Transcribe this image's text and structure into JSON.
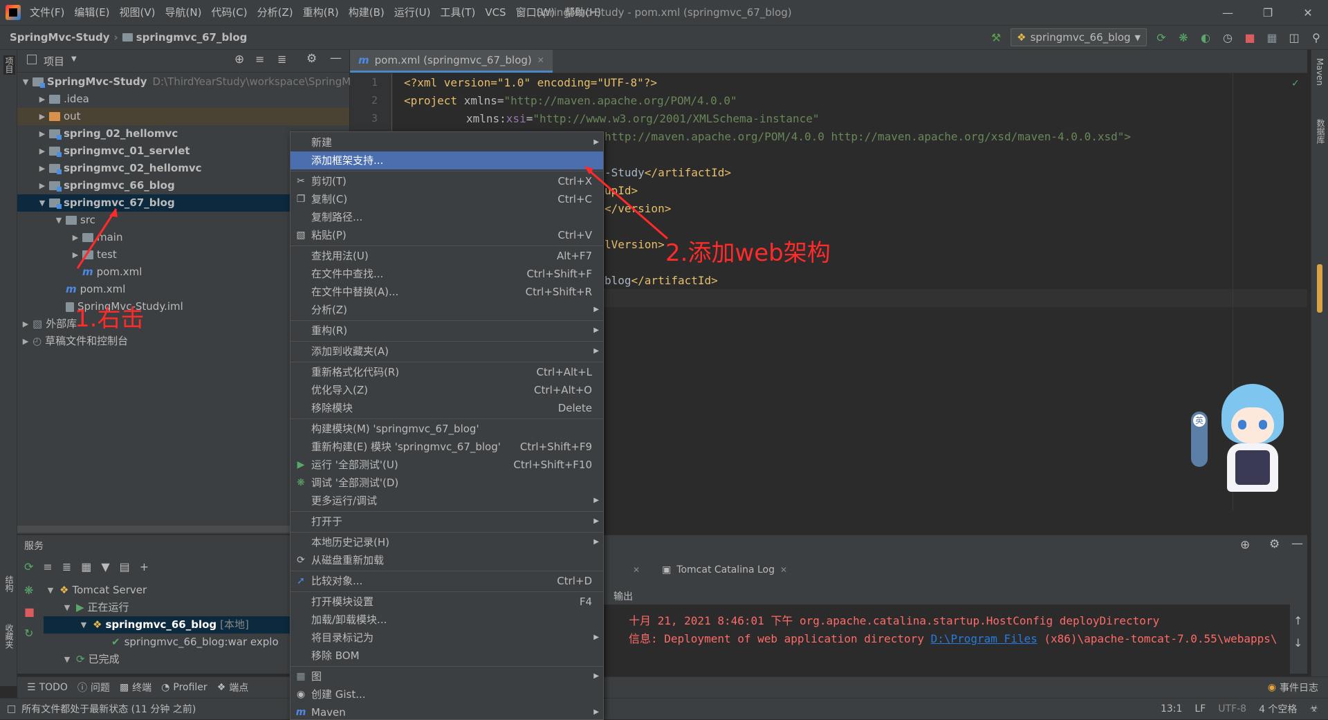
{
  "titlebar": {
    "menu": [
      "文件(F)",
      "编辑(E)",
      "视图(V)",
      "导航(N)",
      "代码(C)",
      "分析(Z)",
      "重构(R)",
      "构建(B)",
      "运行(U)",
      "工具(T)",
      "VCS",
      "窗口(W)",
      "帮助(H)"
    ],
    "window_title": "SpringMvc-Study - pom.xml (springmvc_67_blog)"
  },
  "navbar": {
    "crumb_project": "SpringMvc-Study",
    "crumb_module": "springmvc_67_blog",
    "run_config": "springmvc_66_blog"
  },
  "project_panel": {
    "title": "项目",
    "root_name": "SpringMvc-Study",
    "root_path": "D:\\ThirdYearStudy\\workspace\\SpringM",
    "items": [
      ".idea",
      "out",
      "spring_02_hellomvc",
      "springmvc_01_servlet",
      "springmvc_02_hellomvc",
      "springmvc_66_blog",
      "springmvc_67_blog",
      "src",
      "main",
      "test",
      "pom.xml",
      "pom.xml",
      "SpringMvc-Study.iml",
      "外部库",
      "草稿文件和控制台"
    ]
  },
  "editor": {
    "tab_label": "pom.xml (springmvc_67_blog)",
    "line_numbers": [
      "1",
      "2",
      "3"
    ],
    "code": {
      "l1": "<?xml version=\"1.0\" encoding=\"UTF-8\"?>",
      "l2_tag": "<project ",
      "l2_attr": "xmlns=",
      "l2_val": "\"http://maven.apache.org/POM/4.0.0\"",
      "l3_attr": "xmlns:",
      "l3_ns": "xsi",
      "l3_eq": "=",
      "l3_val": "\"http://www.w3.org/2001/XMLSchema-instance\"",
      "l4_val": "http://maven.apache.org/POM/4.0.0 http://maven.apache.org/xsd/maven-4.0.0.xsd\">",
      "l6_text": "-Study",
      "l6_tag": "</artifactId>",
      "l7_text": "upId>",
      "l8_tag": "</version>",
      "l10_text": "lVersion>",
      "l12_text": "blog",
      "l12_tag": "</artifactId>"
    }
  },
  "context_menu": {
    "items": [
      {
        "label": "新建",
        "shortcut": ""
      },
      {
        "label": "添加框架支持...",
        "shortcut": ""
      },
      {
        "label": "剪切(T)",
        "shortcut": "Ctrl+X"
      },
      {
        "label": "复制(C)",
        "shortcut": "Ctrl+C"
      },
      {
        "label": "复制路径...",
        "shortcut": ""
      },
      {
        "label": "粘贴(P)",
        "shortcut": "Ctrl+V"
      },
      {
        "label": "查找用法(U)",
        "shortcut": "Alt+F7"
      },
      {
        "label": "在文件中查找...",
        "shortcut": "Ctrl+Shift+F"
      },
      {
        "label": "在文件中替换(A)...",
        "shortcut": "Ctrl+Shift+R"
      },
      {
        "label": "分析(Z)",
        "shortcut": ""
      },
      {
        "label": "重构(R)",
        "shortcut": ""
      },
      {
        "label": "添加到收藏夹(A)",
        "shortcut": ""
      },
      {
        "label": "重新格式化代码(R)",
        "shortcut": "Ctrl+Alt+L"
      },
      {
        "label": "优化导入(Z)",
        "shortcut": "Ctrl+Alt+O"
      },
      {
        "label": "移除模块",
        "shortcut": "Delete"
      },
      {
        "label": "构建模块(M) 'springmvc_67_blog'",
        "shortcut": ""
      },
      {
        "label": "重新构建(E) 模块 'springmvc_67_blog'",
        "shortcut": "Ctrl+Shift+F9"
      },
      {
        "label": "运行 '全部测试'(U)",
        "shortcut": "Ctrl+Shift+F10"
      },
      {
        "label": "调试 '全部测试'(D)",
        "shortcut": ""
      },
      {
        "label": "更多运行/调试",
        "shortcut": ""
      },
      {
        "label": "打开于",
        "shortcut": ""
      },
      {
        "label": "本地历史记录(H)",
        "shortcut": ""
      },
      {
        "label": "从磁盘重新加载",
        "shortcut": ""
      },
      {
        "label": "比较对象...",
        "shortcut": "Ctrl+D"
      },
      {
        "label": "打开模块设置",
        "shortcut": "F4"
      },
      {
        "label": "加载/卸载模块...",
        "shortcut": ""
      },
      {
        "label": "将目录标记为",
        "shortcut": ""
      },
      {
        "label": "移除 BOM",
        "shortcut": ""
      },
      {
        "label": "图",
        "shortcut": ""
      },
      {
        "label": "创建 Gist...",
        "shortcut": ""
      },
      {
        "label": "Maven",
        "shortcut": ""
      }
    ]
  },
  "annotations": {
    "step1": "1.右击",
    "step2": "2.添加web架构"
  },
  "services": {
    "title": "服务",
    "tomcat_server": "Tomcat Server",
    "running": "正在运行",
    "blog_module": "springmvc_66_blog",
    "local_tag": "[本地]",
    "artifact": "springmvc_66_blog:war explo",
    "finished": "已完成",
    "log_tab": "Tomcat Catalina Log",
    "output_label": "输出",
    "log_line1": "十月 21, 2021 8:46:01 下午 org.apache.catalina.startup.HostConfig deployDirectory",
    "log_line2_prefix": "信息: Deployment of web application directory ",
    "log_line2_link": "D:\\Program Files",
    "log_line2_suffix": " (x86)\\apache-tomcat-7.0.55\\webapps\\"
  },
  "tool_strip": {
    "todo": "TODO",
    "problems": "问题",
    "terminal": "终端",
    "profiler": "Profiler",
    "endpoints": "端点",
    "event_log": "事件日志"
  },
  "status_bar": {
    "message": "所有文件都处于最新状态 (11 分钟 之前)",
    "position": "13:1",
    "line_sep": "LF",
    "encoding": "UTF-8",
    "indent": "4 个空格"
  },
  "stripes": {
    "left_top": "项目",
    "left_structure": "结构",
    "left_favorites": "收藏夹",
    "right_maven": "Maven",
    "right_db": "数据库"
  },
  "mascot": {
    "badge": "英"
  },
  "colors": {
    "accent_blue": "#4b6eaf",
    "annotation_red": "#ff2a2a",
    "log_red": "#ff6b68"
  }
}
